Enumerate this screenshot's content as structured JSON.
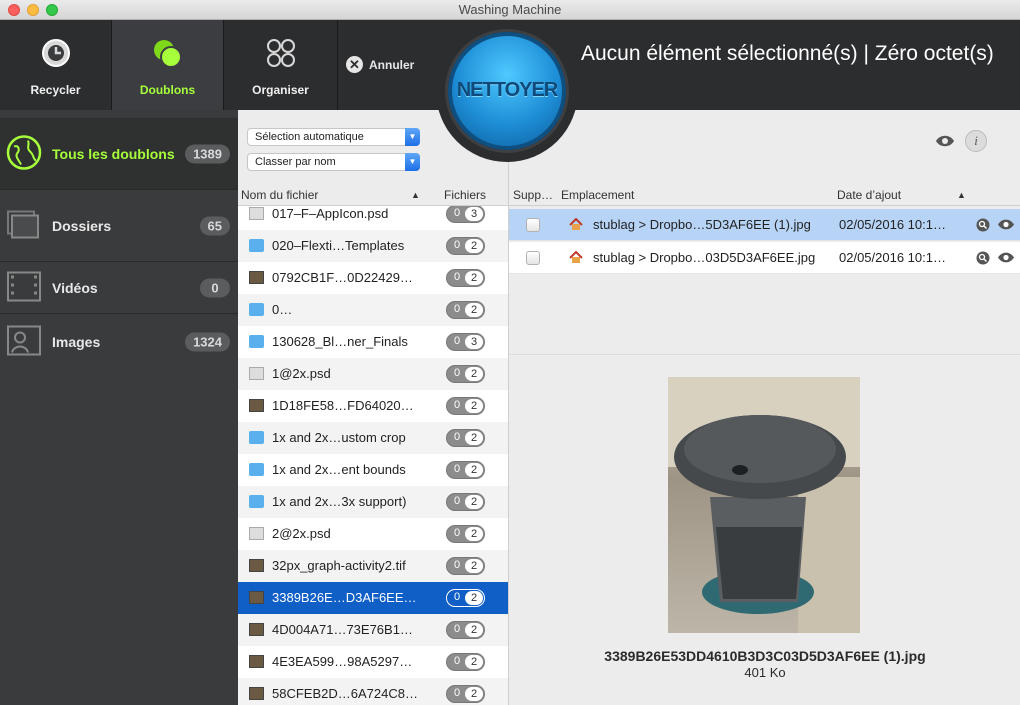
{
  "window": {
    "title": "Washing Machine"
  },
  "toolbar": {
    "buttons": [
      {
        "label": "Recycler",
        "icon": "recycle-clock-icon"
      },
      {
        "label": "Doublons",
        "icon": "duplicates-icon"
      },
      {
        "label": "Organiser",
        "icon": "organize-icon"
      }
    ],
    "cancel_label": "Annuler",
    "clean_label": "NETTOYER",
    "status": "Aucun élément sélectionné(s) | Zéro octet(s)"
  },
  "sidebar": {
    "items": [
      {
        "label": "Tous les doublons",
        "count": "1389",
        "icon": "globe-icon"
      },
      {
        "label": "Dossiers",
        "count": "65",
        "icon": "folders-icon"
      },
      {
        "label": "Vidéos",
        "count": "0",
        "icon": "film-icon"
      },
      {
        "label": "Images",
        "count": "1324",
        "icon": "photo-icon"
      }
    ]
  },
  "filters": {
    "selection": "Sélection automatique",
    "sort": "Classer par nom"
  },
  "file_list": {
    "col_name": "Nom du fichier",
    "col_files": "Fichiers",
    "rows": [
      {
        "name": "017–F–AppIcon.psd",
        "a": "0",
        "b": "3",
        "kind": "psd"
      },
      {
        "name": "020–Flexti…Templates",
        "a": "0",
        "b": "2",
        "kind": "folder"
      },
      {
        "name": "0792CB1F…0D22429…",
        "a": "0",
        "b": "2",
        "kind": "image"
      },
      {
        "name": "0…",
        "a": "0",
        "b": "2",
        "kind": "folder"
      },
      {
        "name": "130628_Bl…ner_Finals",
        "a": "0",
        "b": "3",
        "kind": "folder"
      },
      {
        "name": "1@2x.psd",
        "a": "0",
        "b": "2",
        "kind": "doc"
      },
      {
        "name": "1D18FE58…FD64020…",
        "a": "0",
        "b": "2",
        "kind": "image"
      },
      {
        "name": "1x and 2x…ustom crop",
        "a": "0",
        "b": "2",
        "kind": "folder"
      },
      {
        "name": "1x and 2x…ent bounds",
        "a": "0",
        "b": "2",
        "kind": "folder"
      },
      {
        "name": "1x and 2x…3x support)",
        "a": "0",
        "b": "2",
        "kind": "folder"
      },
      {
        "name": "2@2x.psd",
        "a": "0",
        "b": "2",
        "kind": "doc"
      },
      {
        "name": "32px_graph-activity2.tif",
        "a": "0",
        "b": "2",
        "kind": "image"
      },
      {
        "name": "3389B26E…D3AF6EE…",
        "a": "0",
        "b": "2",
        "kind": "image",
        "selected": true
      },
      {
        "name": "4D004A71…73E76B1…",
        "a": "0",
        "b": "2",
        "kind": "image"
      },
      {
        "name": "4E3EA599…98A5297…",
        "a": "0",
        "b": "2",
        "kind": "image"
      },
      {
        "name": "58CFEB2D…6A724C8…",
        "a": "0",
        "b": "2",
        "kind": "image"
      }
    ]
  },
  "detail": {
    "col_delete": "Supp…",
    "col_location": "Emplacement",
    "col_date": "Date d’ajout",
    "rows": [
      {
        "location": "stublag > Dropbo…5D3AF6EE (1).jpg",
        "date": "02/05/2016 10:1…",
        "highlight": true
      },
      {
        "location": "stublag > Dropbo…03D5D3AF6EE.jpg",
        "date": "02/05/2016 10:1…",
        "highlight": false
      }
    ],
    "preview_filename": "3389B26E53DD4610B3D3C03D5D3AF6EE (1).jpg",
    "preview_size": "401 Ko",
    "info_icon_text": "i"
  }
}
